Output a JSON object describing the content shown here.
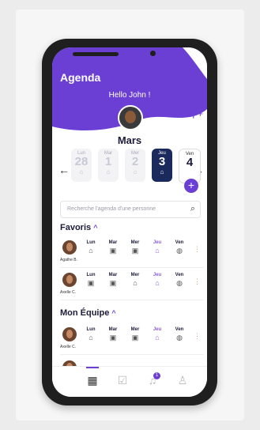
{
  "app": {
    "title": "Agenda",
    "greeting": "Hello John !"
  },
  "calendar": {
    "month": "Mars",
    "days": [
      {
        "name": "Lun",
        "date": "28",
        "icon": "briefcase-icon"
      },
      {
        "name": "Mar",
        "date": "1",
        "icon": "briefcase-icon"
      },
      {
        "name": "Mer",
        "date": "2",
        "icon": "home-icon"
      },
      {
        "name": "Jeu",
        "date": "3",
        "icon": "briefcase-icon"
      },
      {
        "name": "Ven",
        "date": "4",
        "icon": "none"
      }
    ],
    "prev_arrow": "←",
    "next_arrow": "→",
    "add_label": "+"
  },
  "search": {
    "placeholder": "Recherche l'agenda d'une personne",
    "icon": "search-icon"
  },
  "favoris": {
    "title": "Favoris",
    "people": [
      {
        "name": "Agathe B.",
        "days": [
          "Lun",
          "Mar",
          "Mer",
          "Jeu",
          "Ven"
        ],
        "icons": [
          "home-icon",
          "briefcase-icon",
          "briefcase-icon",
          "home-icon",
          "globe-icon"
        ]
      },
      {
        "name": "Axelle C.",
        "days": [
          "Lun",
          "Mar",
          "Mer",
          "Jeu",
          "Ven"
        ],
        "icons": [
          "briefcase-icon",
          "briefcase-icon",
          "home-icon",
          "home-icon",
          "globe-icon"
        ]
      }
    ]
  },
  "equipe": {
    "title": "Mon Équipe",
    "people": [
      {
        "name": "Axelle C.",
        "days": [
          "Lun",
          "Mar",
          "Mer",
          "Jeu",
          "Ven"
        ],
        "icons": [
          "home-icon",
          "briefcase-icon",
          "briefcase-icon",
          "home-icon",
          "globe-icon"
        ]
      }
    ]
  },
  "tabbar": {
    "notification_count": "1"
  },
  "colors": {
    "accent": "#6b3fd4",
    "navy": "#1b2a5c"
  }
}
